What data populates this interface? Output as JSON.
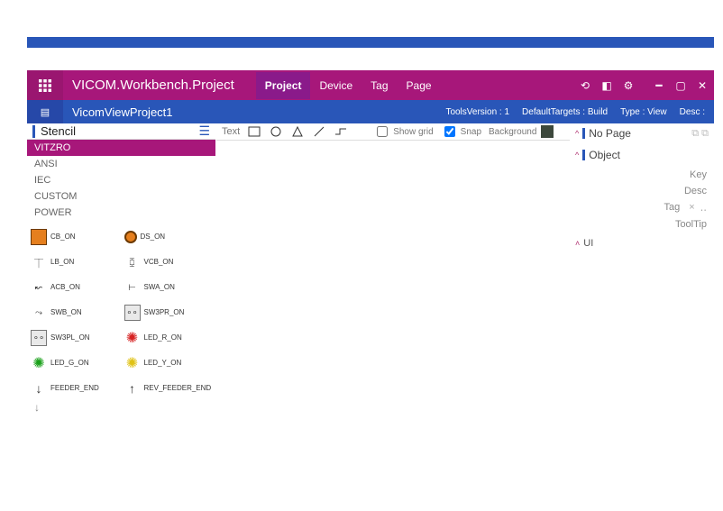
{
  "app": {
    "title": "VICOM.Workbench.Project",
    "menu": [
      {
        "label": "Project",
        "active": true
      },
      {
        "label": "Device",
        "active": false
      },
      {
        "label": "Tag",
        "active": false
      },
      {
        "label": "Page",
        "active": false
      }
    ]
  },
  "subbar": {
    "project_name": "VicomViewProject1",
    "tools_version_label": "ToolsVersion :",
    "tools_version_value": "1",
    "default_targets_label": "DefaultTargets :",
    "default_targets_value": "Build",
    "type_label": "Type :",
    "type_value": "View",
    "desc_label": "Desc :",
    "desc_value": ""
  },
  "stencil": {
    "header": "Stencil",
    "categories": [
      {
        "label": "VITZRO",
        "active": true
      },
      {
        "label": "ANSI",
        "active": false
      },
      {
        "label": "IEC",
        "active": false
      },
      {
        "label": "CUSTOM",
        "active": false
      },
      {
        "label": "POWER",
        "active": false
      }
    ],
    "shapes": [
      {
        "label": "CB_ON",
        "glyph": "box-orange"
      },
      {
        "label": "DS_ON",
        "glyph": "circ-orange"
      },
      {
        "label": "LB_ON",
        "glyph": "lb"
      },
      {
        "label": "VCB_ON",
        "glyph": "vcb"
      },
      {
        "label": "ACB_ON",
        "glyph": "acb"
      },
      {
        "label": "SWA_ON",
        "glyph": "swa"
      },
      {
        "label": "SWB_ON",
        "glyph": "swb"
      },
      {
        "label": "SW3PR_ON",
        "glyph": "box-grey"
      },
      {
        "label": "SW3PL_ON",
        "glyph": "box-grey"
      },
      {
        "label": "LED_R_ON",
        "glyph": "star-r"
      },
      {
        "label": "LED_G_ON",
        "glyph": "star-g"
      },
      {
        "label": "LED_Y_ON",
        "glyph": "star-y"
      },
      {
        "label": "FEEDER_END",
        "glyph": "arr-down"
      },
      {
        "label": "REV_FEEDER_END",
        "glyph": "arr-up"
      }
    ]
  },
  "toolbar": {
    "text_label": "Text",
    "show_grid_label": "Show grid",
    "show_grid_checked": false,
    "snap_label": "Snap",
    "snap_checked": true,
    "background_label": "Background"
  },
  "right": {
    "nopage": {
      "label": "No Page"
    },
    "object": {
      "label": "Object"
    },
    "props": [
      {
        "key": "Key"
      },
      {
        "key": "Desc"
      },
      {
        "key": "Tag",
        "hasx": true
      },
      {
        "key": "ToolTip"
      }
    ],
    "ui_label": "UI"
  }
}
